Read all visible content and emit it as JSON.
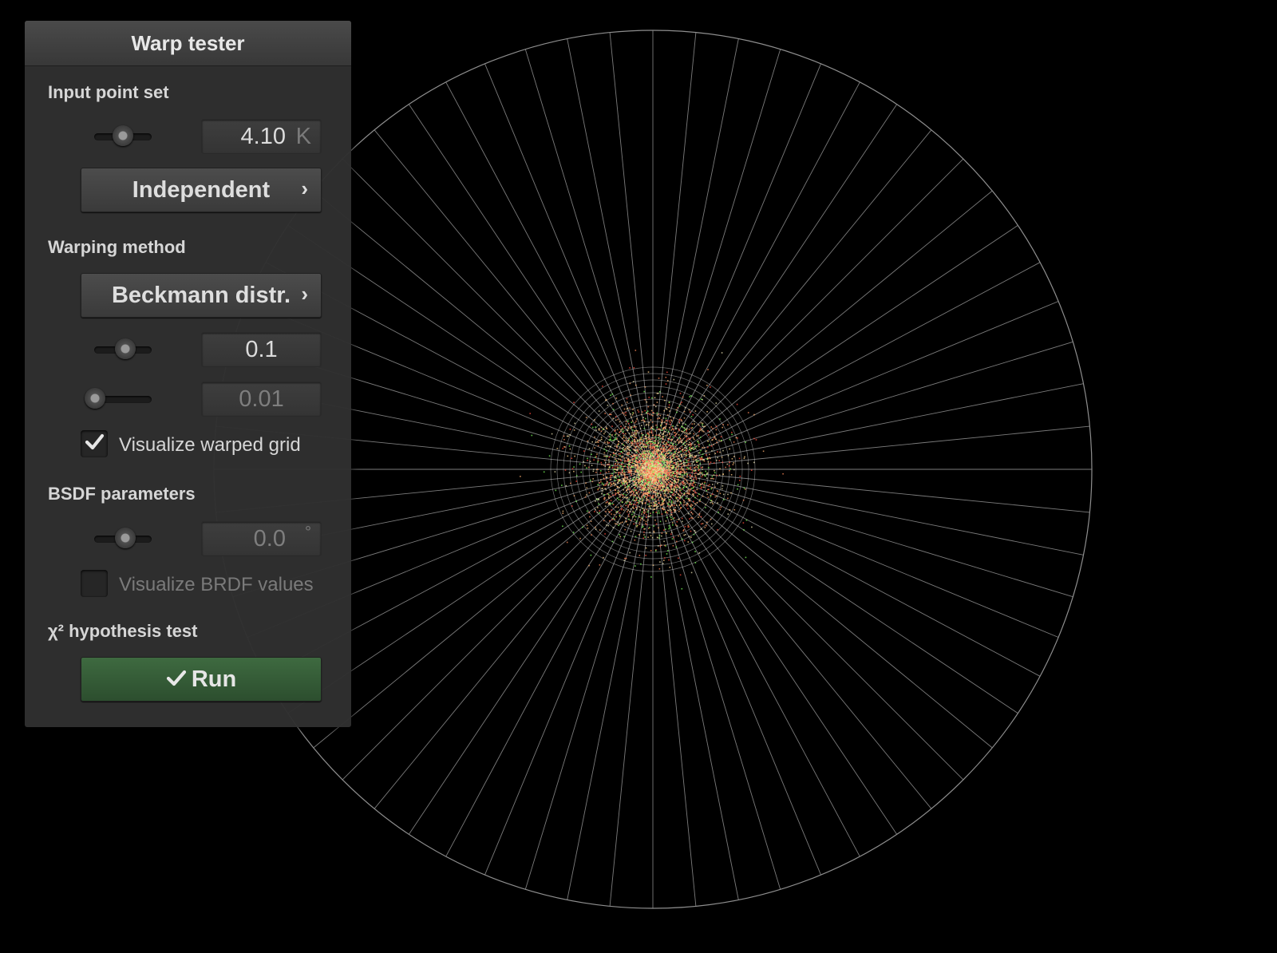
{
  "window": {
    "title": "Warp tester"
  },
  "input_point_set": {
    "label": "Input point set",
    "point_count_slider": 0.5,
    "point_count_value": "4.10",
    "point_count_unit": "K",
    "point_type_button": "Independent",
    "chevron": "›"
  },
  "warping_method": {
    "label": "Warping method",
    "method_button": "Beckmann distr.",
    "chevron": "›",
    "param1_slider": 0.55,
    "param1_value": "0.1",
    "param2_slider": 0.0,
    "param2_value": "0.01",
    "visualize_grid_label": "Visualize warped grid",
    "visualize_grid_checked": true
  },
  "bsdf_parameters": {
    "label": "BSDF parameters",
    "angle_slider": 0.55,
    "angle_value": "0.0",
    "angle_unit": "°",
    "visualize_brdf_label": "Visualize BRDF values",
    "visualize_brdf_checked": false
  },
  "hypothesis_test": {
    "label": "χ² hypothesis test",
    "run_button": "Run",
    "run_icon": "checkmark-icon"
  },
  "colors": {
    "background": "#000000",
    "panel": "#303030",
    "run_button": "#345a36",
    "grid_lines": "#9a9a9a",
    "points_warm": "#ffb070",
    "points_green": "#7cff5a",
    "points_red": "#ff4a3a"
  }
}
